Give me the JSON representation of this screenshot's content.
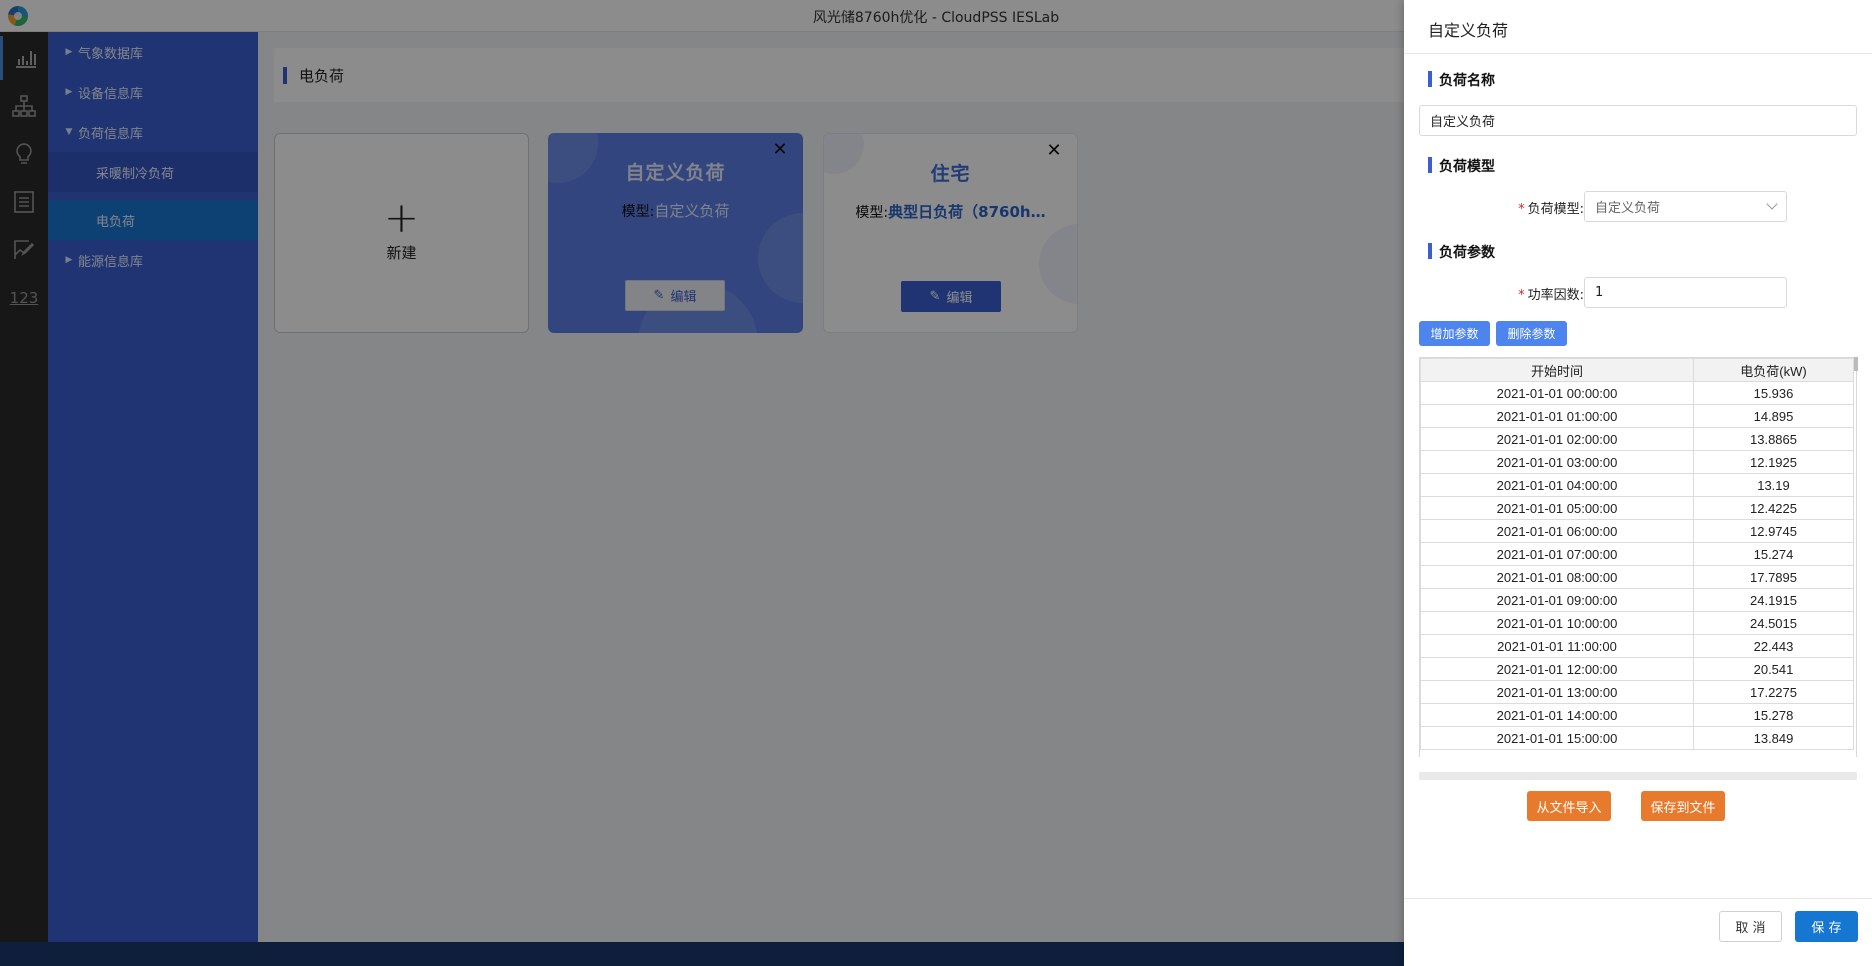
{
  "window": {
    "title": "风光储8760h优化 - CloudPSS IESLab"
  },
  "rail": {
    "items": [
      {
        "icon": "bar-chart-icon"
      },
      {
        "icon": "org-tree-icon"
      },
      {
        "icon": "lightbulb-icon"
      },
      {
        "icon": "document-list-icon"
      },
      {
        "icon": "edit-chart-icon"
      },
      {
        "icon": "numbers-icon",
        "text": "123"
      }
    ]
  },
  "nav": {
    "items": [
      {
        "label": "气象数据库"
      },
      {
        "label": "设备信息库"
      },
      {
        "label": "负荷信息库"
      },
      {
        "label": "采暖制冷负荷"
      },
      {
        "label": "电负荷"
      },
      {
        "label": "能源信息库"
      }
    ]
  },
  "main": {
    "header_title": "电负荷",
    "new_card_label": "新建",
    "cards": [
      {
        "title": "自定义负荷",
        "model_key": "模型:",
        "model_value": "自定义负荷",
        "edit_label": "编辑"
      },
      {
        "title": "住宅",
        "model_key": "模型:",
        "model_value": "典型日负荷（8760h…",
        "edit_label": "编辑"
      }
    ]
  },
  "drawer": {
    "title": "自定义负荷",
    "section_name": "负荷名称",
    "name_value": "自定义负荷",
    "section_model": "负荷模型",
    "model_label": "负荷模型:",
    "model_value": "自定义负荷",
    "section_params": "负荷参数",
    "pf_label": "功率因数:",
    "pf_value": "1",
    "add_param": "增加参数",
    "del_param": "删除参数",
    "table": {
      "headers": [
        "开始时间",
        "电负荷(kW)"
      ],
      "rows": [
        [
          "2021-01-01 00:00:00",
          "15.936"
        ],
        [
          "2021-01-01 01:00:00",
          "14.895"
        ],
        [
          "2021-01-01 02:00:00",
          "13.8865"
        ],
        [
          "2021-01-01 03:00:00",
          "12.1925"
        ],
        [
          "2021-01-01 04:00:00",
          "13.19"
        ],
        [
          "2021-01-01 05:00:00",
          "12.4225"
        ],
        [
          "2021-01-01 06:00:00",
          "12.9745"
        ],
        [
          "2021-01-01 07:00:00",
          "15.274"
        ],
        [
          "2021-01-01 08:00:00",
          "17.7895"
        ],
        [
          "2021-01-01 09:00:00",
          "24.1915"
        ],
        [
          "2021-01-01 10:00:00",
          "24.5015"
        ],
        [
          "2021-01-01 11:00:00",
          "22.443"
        ],
        [
          "2021-01-01 12:00:00",
          "20.541"
        ],
        [
          "2021-01-01 13:00:00",
          "17.2275"
        ],
        [
          "2021-01-01 14:00:00",
          "15.278"
        ],
        [
          "2021-01-01 15:00:00",
          "13.849"
        ]
      ]
    },
    "import_label": "从文件导入",
    "export_label": "保存到文件",
    "cancel_label": "取 消",
    "save_label": "保 存"
  },
  "colors": {
    "nav_bg": "#3b5fd1",
    "accent": "#1677d2",
    "orange": "#e87a2e",
    "rail_bg": "#2a2a2a"
  }
}
